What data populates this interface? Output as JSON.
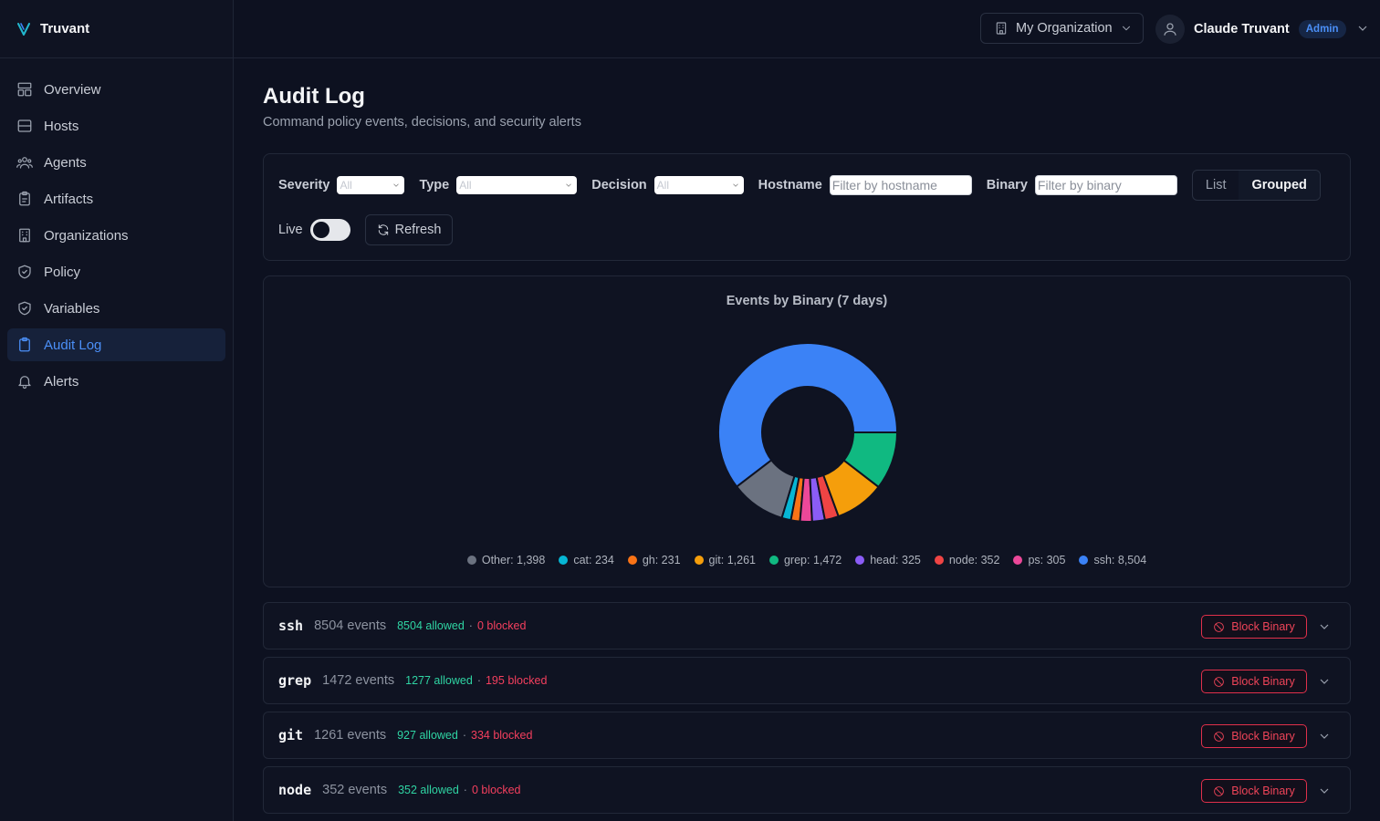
{
  "brand": {
    "name": "Truvant"
  },
  "sidebar": {
    "items": [
      {
        "label": "Overview",
        "icon": "layout-icon"
      },
      {
        "label": "Hosts",
        "icon": "server-icon"
      },
      {
        "label": "Agents",
        "icon": "users-icon"
      },
      {
        "label": "Artifacts",
        "icon": "clipboard-icon"
      },
      {
        "label": "Organizations",
        "icon": "building-icon"
      },
      {
        "label": "Policy",
        "icon": "shield-check-icon"
      },
      {
        "label": "Variables",
        "icon": "shield-icon"
      },
      {
        "label": "Audit Log",
        "icon": "clipboard-list-icon",
        "active": true
      },
      {
        "label": "Alerts",
        "icon": "bell-icon"
      }
    ]
  },
  "header": {
    "org_label": "My Organization",
    "user_name": "Claude Truvant",
    "role_badge": "Admin"
  },
  "page": {
    "title": "Audit Log",
    "subtitle": "Command policy events, decisions, and security alerts"
  },
  "filters": {
    "severity_label": "Severity",
    "severity_value": "All",
    "type_label": "Type",
    "type_value": "All",
    "decision_label": "Decision",
    "decision_value": "All",
    "hostname_label": "Hostname",
    "hostname_placeholder": "Filter by hostname",
    "binary_label": "Binary",
    "binary_placeholder": "Filter by binary",
    "view_list": "List",
    "view_grouped": "Grouped",
    "view_selected": "Grouped",
    "live_label": "Live",
    "live_on": false,
    "refresh_label": "Refresh"
  },
  "chart_data": {
    "type": "pie",
    "title": "Events by Binary (7 days)",
    "slices": [
      {
        "label": "ssh",
        "value": 8504,
        "color": "#3b82f6"
      },
      {
        "label": "Other",
        "value": 1398,
        "color": "#6b7280"
      },
      {
        "label": "cat",
        "value": 234,
        "color": "#06b6d4"
      },
      {
        "label": "gh",
        "value": 231,
        "color": "#f97316"
      },
      {
        "label": "ps",
        "value": 305,
        "color": "#ec4899"
      },
      {
        "label": "head",
        "value": 325,
        "color": "#8b5cf6"
      },
      {
        "label": "node",
        "value": 352,
        "color": "#ef4444"
      },
      {
        "label": "git",
        "value": 1261,
        "color": "#f59e0b"
      },
      {
        "label": "grep",
        "value": 1472,
        "color": "#10b981"
      }
    ],
    "legend": [
      {
        "text": "Other: 1,398",
        "color": "#6b7280"
      },
      {
        "text": "cat: 234",
        "color": "#06b6d4"
      },
      {
        "text": "gh: 231",
        "color": "#f97316"
      },
      {
        "text": "git: 1,261",
        "color": "#f59e0b"
      },
      {
        "text": "grep: 1,472",
        "color": "#10b981"
      },
      {
        "text": "head: 325",
        "color": "#8b5cf6"
      },
      {
        "text": "node: 352",
        "color": "#ef4444"
      },
      {
        "text": "ps: 305",
        "color": "#ec4899"
      },
      {
        "text": "ssh: 8,504",
        "color": "#3b82f6"
      }
    ],
    "legend_position": "bottom"
  },
  "groups": [
    {
      "binary": "ssh",
      "events": "8504 events",
      "allowed": "8504 allowed",
      "sep": "·",
      "blocked": "0 blocked",
      "action": "Block Binary"
    },
    {
      "binary": "grep",
      "events": "1472 events",
      "allowed": "1277 allowed",
      "sep": "·",
      "blocked": "195 blocked",
      "action": "Block Binary"
    },
    {
      "binary": "git",
      "events": "1261 events",
      "allowed": "927 allowed",
      "sep": "·",
      "blocked": "334 blocked",
      "action": "Block Binary"
    },
    {
      "binary": "node",
      "events": "352 events",
      "allowed": "352 allowed",
      "sep": "·",
      "blocked": "0 blocked",
      "action": "Block Binary"
    }
  ]
}
